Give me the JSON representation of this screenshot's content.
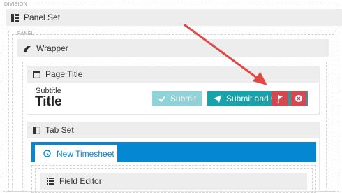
{
  "colors": {
    "submit_disabled": "#8dd3d8",
    "submit_close": "#16a3aa",
    "danger": "#d6484f",
    "tab_bar": "#0587d1",
    "arrow": "#e04a44"
  },
  "division": {
    "label": "DIVISION"
  },
  "panel_set": {
    "label": "Panel Set",
    "icon": "panel-set-icon"
  },
  "panel": {
    "label": "PANEL"
  },
  "wrapper": {
    "label": "Wrapper",
    "icon": "eraser-icon"
  },
  "page_title_block": {
    "label": "Page Title",
    "icon": "window-icon",
    "subtitle": "Subtitle",
    "title": "Title",
    "submit_label": "Submit",
    "submit_close_label": "Submit and C",
    "submit_close_icon": "paper-plane-icon",
    "overlay_icons": [
      "flag-icon",
      "close-circle-icon"
    ]
  },
  "tab_set": {
    "label": "Tab Set",
    "icon": "tabs-icon"
  },
  "tab": {
    "label": "New Timesheet",
    "icon": "clock-icon"
  },
  "field_editor": {
    "label": "Field Editor",
    "icon": "list-icon"
  }
}
